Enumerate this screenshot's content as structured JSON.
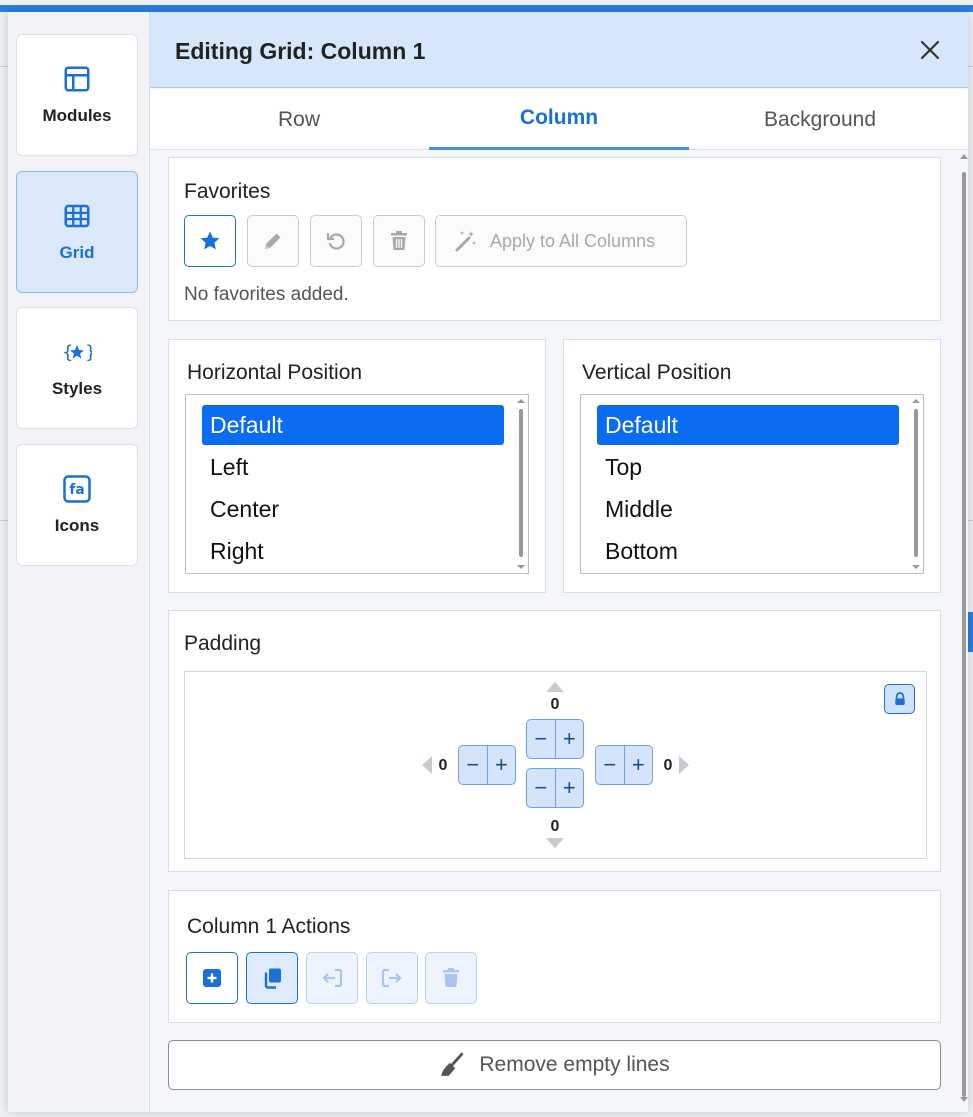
{
  "rail": {
    "items": [
      {
        "label": "Modules",
        "icon": "layout-icon"
      },
      {
        "label": "Grid",
        "icon": "grid-icon"
      },
      {
        "label": "Styles",
        "icon": "styles-icon"
      },
      {
        "label": "Icons",
        "icon": "fa-icon",
        "glyph": "fa"
      }
    ]
  },
  "header": {
    "title": "Editing Grid: Column 1"
  },
  "tabs": [
    {
      "label": "Row"
    },
    {
      "label": "Column"
    },
    {
      "label": "Background"
    }
  ],
  "favorites": {
    "title": "Favorites",
    "apply_label": "Apply to All Columns",
    "empty_text": "No favorites added."
  },
  "horizontal": {
    "title": "Horizontal Position",
    "options": [
      "Default",
      "Left",
      "Center",
      "Right"
    ]
  },
  "vertical": {
    "title": "Vertical Position",
    "options": [
      "Default",
      "Top",
      "Middle",
      "Bottom"
    ]
  },
  "padding": {
    "title": "Padding",
    "top": "0",
    "bottom": "0",
    "left": "0",
    "right": "0",
    "minus": "−",
    "plus": "+"
  },
  "actions": {
    "title": "Column 1 Actions"
  },
  "remove": {
    "label": "Remove empty lines"
  },
  "colors": {
    "accent": "#1a6fd8",
    "selected": "#0a6cf0",
    "header_bg": "#d6e6fb"
  }
}
